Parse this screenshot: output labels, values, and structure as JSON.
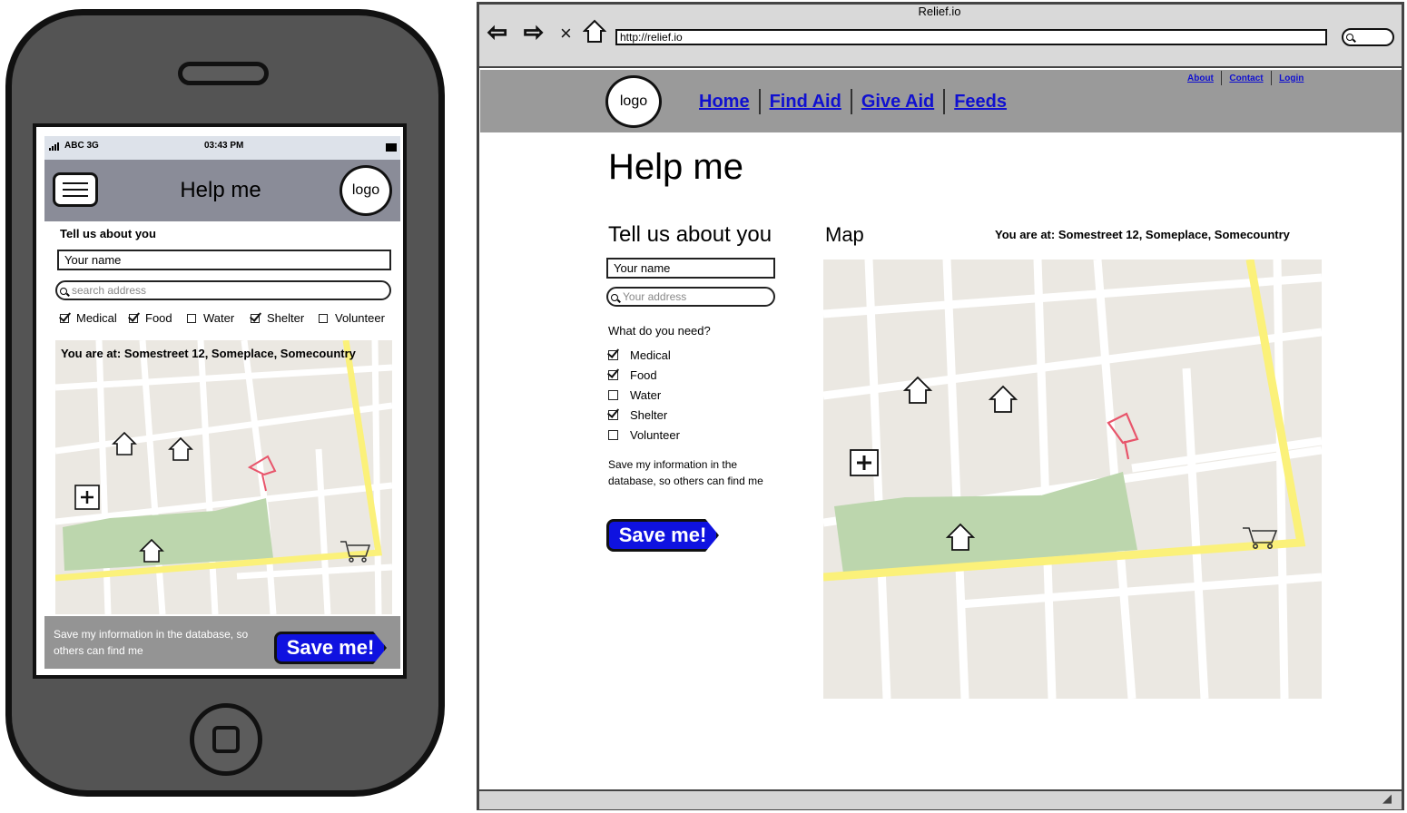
{
  "phone": {
    "status": {
      "carrier": "ABC 3G",
      "time": "03:43 PM"
    },
    "header": {
      "title": "Help me",
      "logo": "logo"
    },
    "about_label": "Tell us about you",
    "name_field": "Your name",
    "search_placeholder": "search address",
    "needs": [
      {
        "label": "Medical",
        "checked": true
      },
      {
        "label": "Food",
        "checked": true
      },
      {
        "label": "Water",
        "checked": false
      },
      {
        "label": "Shelter",
        "checked": true
      },
      {
        "label": "Volunteer",
        "checked": false
      }
    ],
    "location": "You are at: Somestreet 12, Someplace, Somecountry",
    "save_text": "Save my information in the database, so others can find me",
    "save_button": "Save me!"
  },
  "browser": {
    "window_title": "Relief.io",
    "url": "http://relief.io",
    "site": {
      "logo": "logo",
      "nav": [
        "Home",
        "Find Aid",
        "Give Aid",
        "Feeds"
      ],
      "util": [
        "About",
        "Contact",
        "Login"
      ]
    },
    "page_title": "Help me",
    "about_title": "Tell us about you",
    "name_field": "Your name",
    "address_placeholder": "Your address",
    "need_label": "What do you need?",
    "needs": [
      {
        "label": "Medical",
        "checked": true
      },
      {
        "label": "Food",
        "checked": true
      },
      {
        "label": "Water",
        "checked": false
      },
      {
        "label": "Shelter",
        "checked": true
      },
      {
        "label": "Volunteer",
        "checked": false
      }
    ],
    "save_text": "Save my information in the database, so others can find me",
    "save_button": "Save me!",
    "map_title": "Map",
    "location": "You are at: Somestreet 12, Someplace, Somecountry"
  },
  "colors": {
    "save_button": "#0f12e0",
    "link": "#1010d0",
    "map_bg": "#ebe8e2",
    "park": "#bcd6ad",
    "highway": "#fbf17a",
    "pin": "#e8556b"
  }
}
